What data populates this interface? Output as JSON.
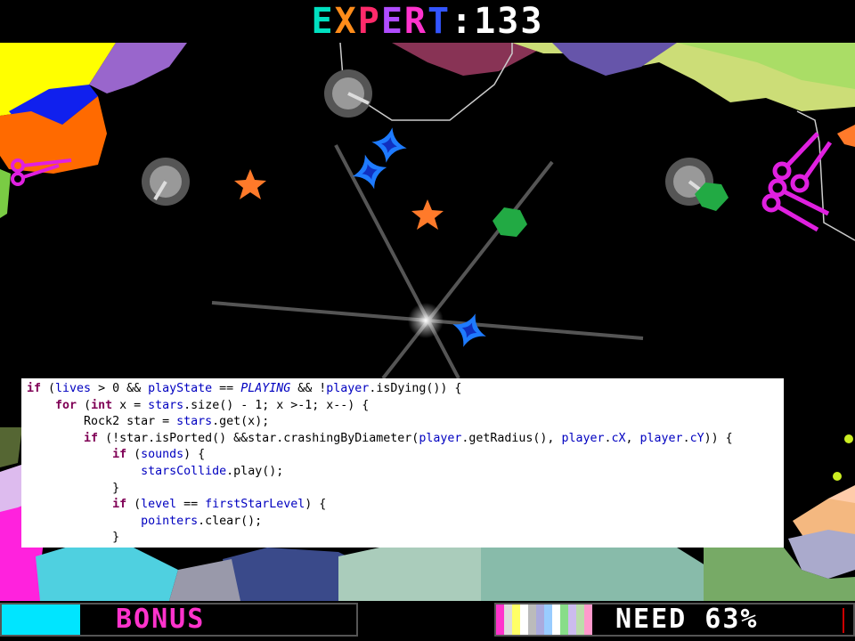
{
  "hud": {
    "title_letters": [
      {
        "ch": "E",
        "color": "#00e0c0"
      },
      {
        "ch": "X",
        "color": "#ff8c1a"
      },
      {
        "ch": "P",
        "color": "#ff2a6a"
      },
      {
        "ch": "E",
        "color": "#b04cff"
      },
      {
        "ch": "R",
        "color": "#ff33cc"
      },
      {
        "ch": "T",
        "color": "#3355ff"
      },
      {
        "ch": ":",
        "color": "#ffffff"
      }
    ],
    "score": "133",
    "score_color": "#ffffff",
    "bonus_label": "BONUS",
    "bonus_fill": 0.22,
    "bonus_color": "#00e5ff",
    "need_label": "NEED 63%",
    "need_stripe_colors": [
      "#ff33cc",
      "#dddddd",
      "#ffff66",
      "#ffffff",
      "#bbbbbb",
      "#aaaadd",
      "#99ccff",
      "#ffffff",
      "#88dd88",
      "#ccbbee",
      "#bbddaa",
      "#ff99cc"
    ]
  },
  "code_lines": [
    [
      {
        "t": "if",
        "c": "kw"
      },
      {
        "t": " ("
      },
      {
        "t": "lives",
        "c": "fld"
      },
      {
        "t": " > 0 && "
      },
      {
        "t": "playState",
        "c": "fld"
      },
      {
        "t": " == "
      },
      {
        "t": "PLAYING",
        "c": "con"
      },
      {
        "t": " && !"
      },
      {
        "t": "player",
        "c": "fld"
      },
      {
        "t": ".isDying()) {"
      }
    ],
    [
      {
        "t": "    "
      },
      {
        "t": "for",
        "c": "kw"
      },
      {
        "t": " ("
      },
      {
        "t": "int",
        "c": "kw"
      },
      {
        "t": " x = "
      },
      {
        "t": "stars",
        "c": "fld"
      },
      {
        "t": ".size() - 1; x >-1; x--) {"
      }
    ],
    [
      {
        "t": "        Rock2 star = "
      },
      {
        "t": "stars",
        "c": "fld"
      },
      {
        "t": ".get(x);"
      }
    ],
    [
      {
        "t": "        "
      },
      {
        "t": "if",
        "c": "kw"
      },
      {
        "t": " (!star.isPorted() &&star.crashingByDiameter("
      },
      {
        "t": "player",
        "c": "fld"
      },
      {
        "t": ".getRadius(), "
      },
      {
        "t": "player",
        "c": "fld"
      },
      {
        "t": "."
      },
      {
        "t": "cX",
        "c": "fld"
      },
      {
        "t": ", "
      },
      {
        "t": "player",
        "c": "fld"
      },
      {
        "t": "."
      },
      {
        "t": "cY",
        "c": "fld"
      },
      {
        "t": ")) {"
      }
    ],
    [
      {
        "t": "            "
      },
      {
        "t": "if",
        "c": "kw"
      },
      {
        "t": " ("
      },
      {
        "t": "sounds",
        "c": "fld"
      },
      {
        "t": ") {"
      }
    ],
    [
      {
        "t": "                "
      },
      {
        "t": "starsCollide",
        "c": "fld"
      },
      {
        "t": ".play();"
      }
    ],
    [
      {
        "t": "            }"
      }
    ],
    [
      {
        "t": "            "
      },
      {
        "t": "if",
        "c": "kw"
      },
      {
        "t": " ("
      },
      {
        "t": "level",
        "c": "fld"
      },
      {
        "t": " == "
      },
      {
        "t": "firstStarLevel",
        "c": "fld"
      },
      {
        "t": ") {"
      }
    ],
    [
      {
        "t": "                "
      },
      {
        "t": "pointers",
        "c": "fld"
      },
      {
        "t": ".clear();"
      }
    ],
    [
      {
        "t": "            }"
      }
    ]
  ],
  "colors": {
    "orange_star": "#ff7a2a",
    "blue_star": "#1e7bff",
    "green_rock": "#22aa44",
    "scissors": "#e020e0",
    "turret": "#8a8a8a"
  }
}
